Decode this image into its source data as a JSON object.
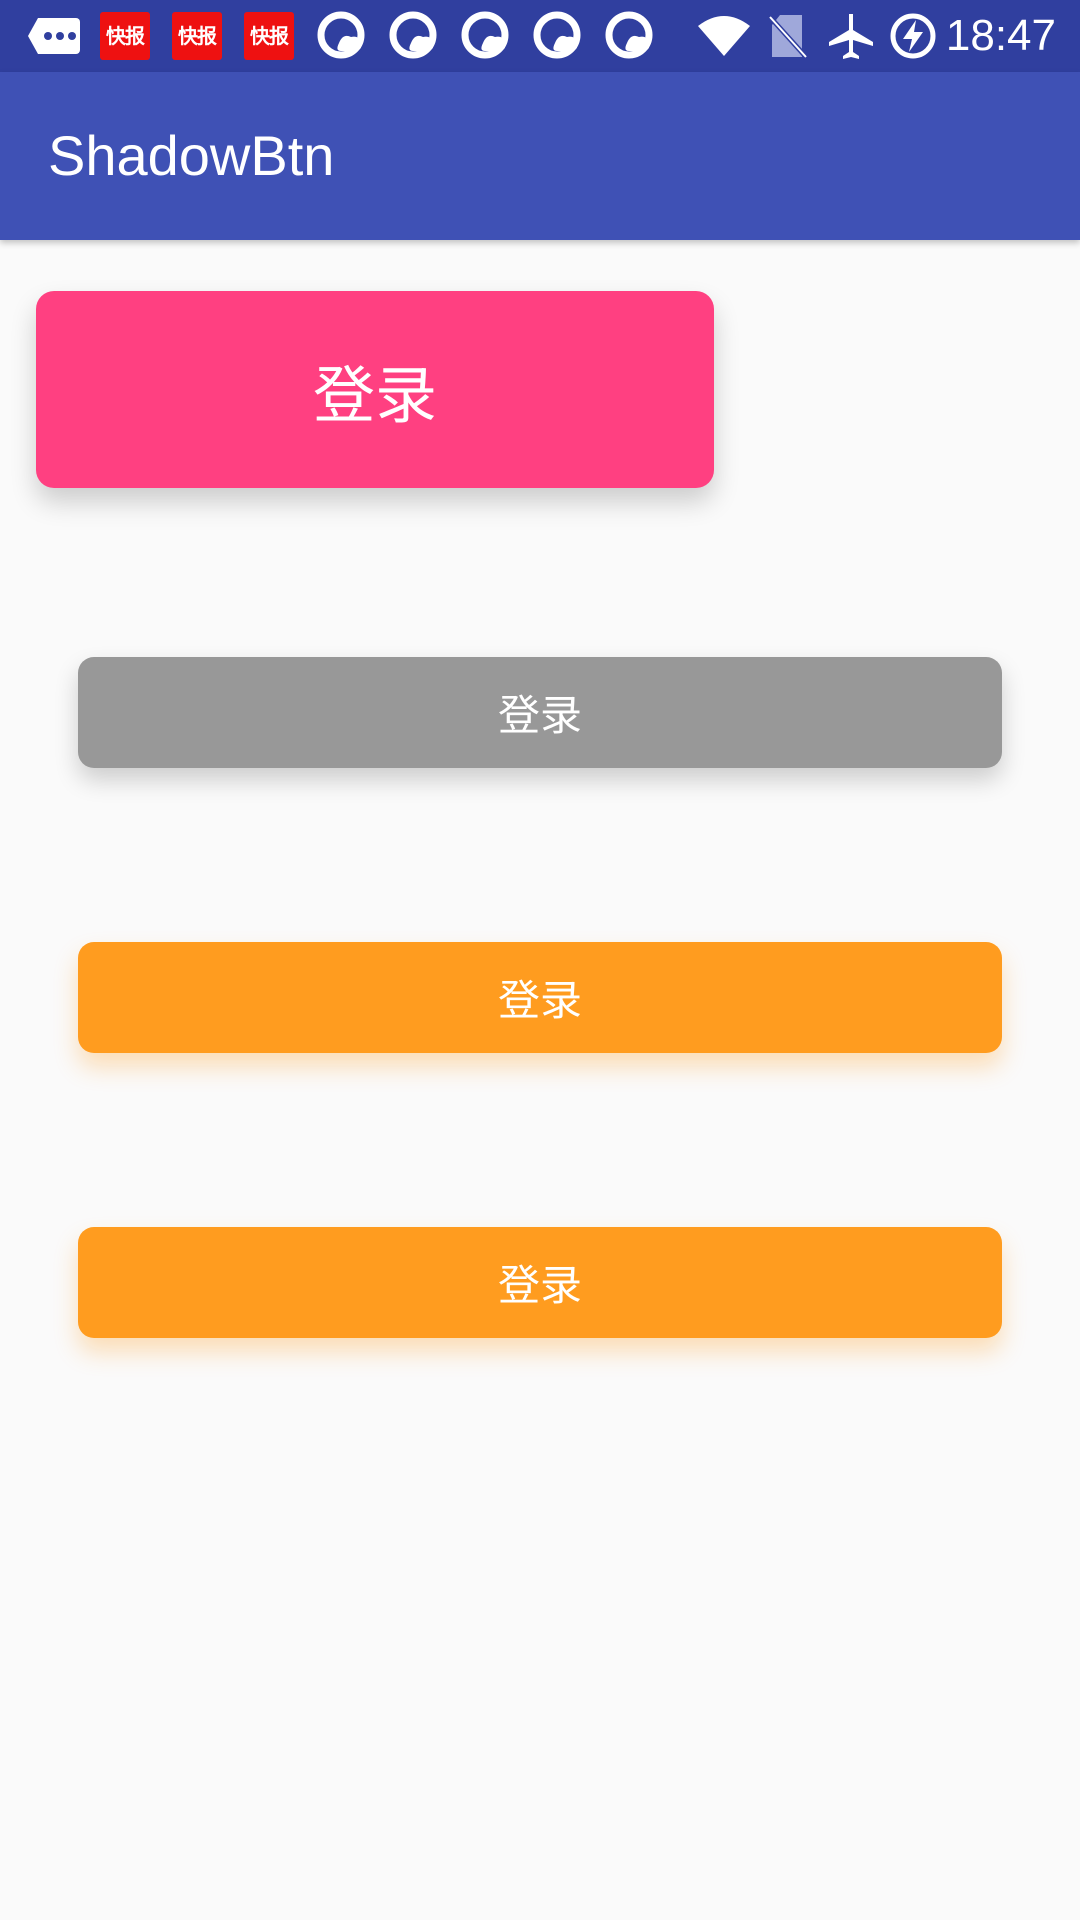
{
  "status_bar": {
    "time": "18:47",
    "notification_badge_text": "快报",
    "icons": [
      "message-icon",
      "news-icon",
      "news-icon",
      "news-icon",
      "q-app-icon",
      "q-app-icon",
      "q-app-icon",
      "q-app-icon",
      "q-app-icon",
      "wifi-icon",
      "no-sim-icon",
      "airplane-mode-icon",
      "battery-charging-icon"
    ]
  },
  "app_bar": {
    "title": "ShadowBtn"
  },
  "buttons": {
    "pink": {
      "label": "登录",
      "color": "#ff4081"
    },
    "gray": {
      "label": "登录",
      "color": "#989898"
    },
    "orange1": {
      "label": "登录",
      "color": "#ff9c1f"
    },
    "orange2": {
      "label": "登录",
      "color": "#ff9c1f"
    }
  },
  "colors": {
    "status_bar": "#303f9f",
    "app_bar": "#3f51b5",
    "background": "#fafafa"
  }
}
